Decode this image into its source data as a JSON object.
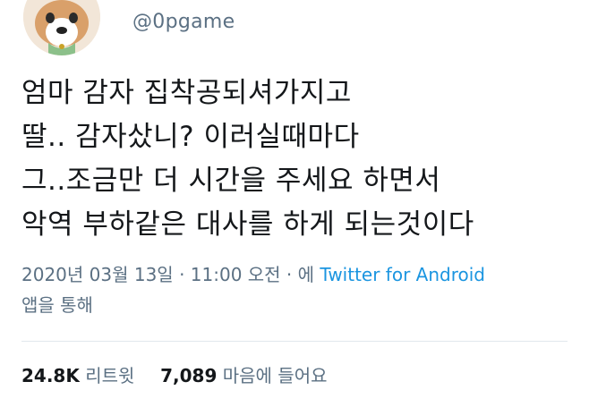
{
  "author": {
    "handle": "@0pgame"
  },
  "tweet": {
    "lines": [
      "엄마 감자 집착공되셔가지고",
      "딸.. 감자샀니? 이러실때마다",
      "그..조금만 더 시간을 주세요 하면서",
      "악역 부하같은 대사를 하게 되는것이다"
    ],
    "timestamp": "2020년 03월 13일 · 11:00 오전 · 에",
    "source": "Twitter for Android",
    "source_suffix": "앱을 통해"
  },
  "stats": {
    "retweets": "24.8K",
    "retweets_label": "리트윗",
    "likes": "7,089",
    "likes_label": "마음에 들어요"
  },
  "colors": {
    "text": "#14171a",
    "secondary": "#5b7083",
    "link": "#1b95e0",
    "divider": "#e1e8ed"
  },
  "icons": {
    "avatar": "dog-avatar"
  }
}
